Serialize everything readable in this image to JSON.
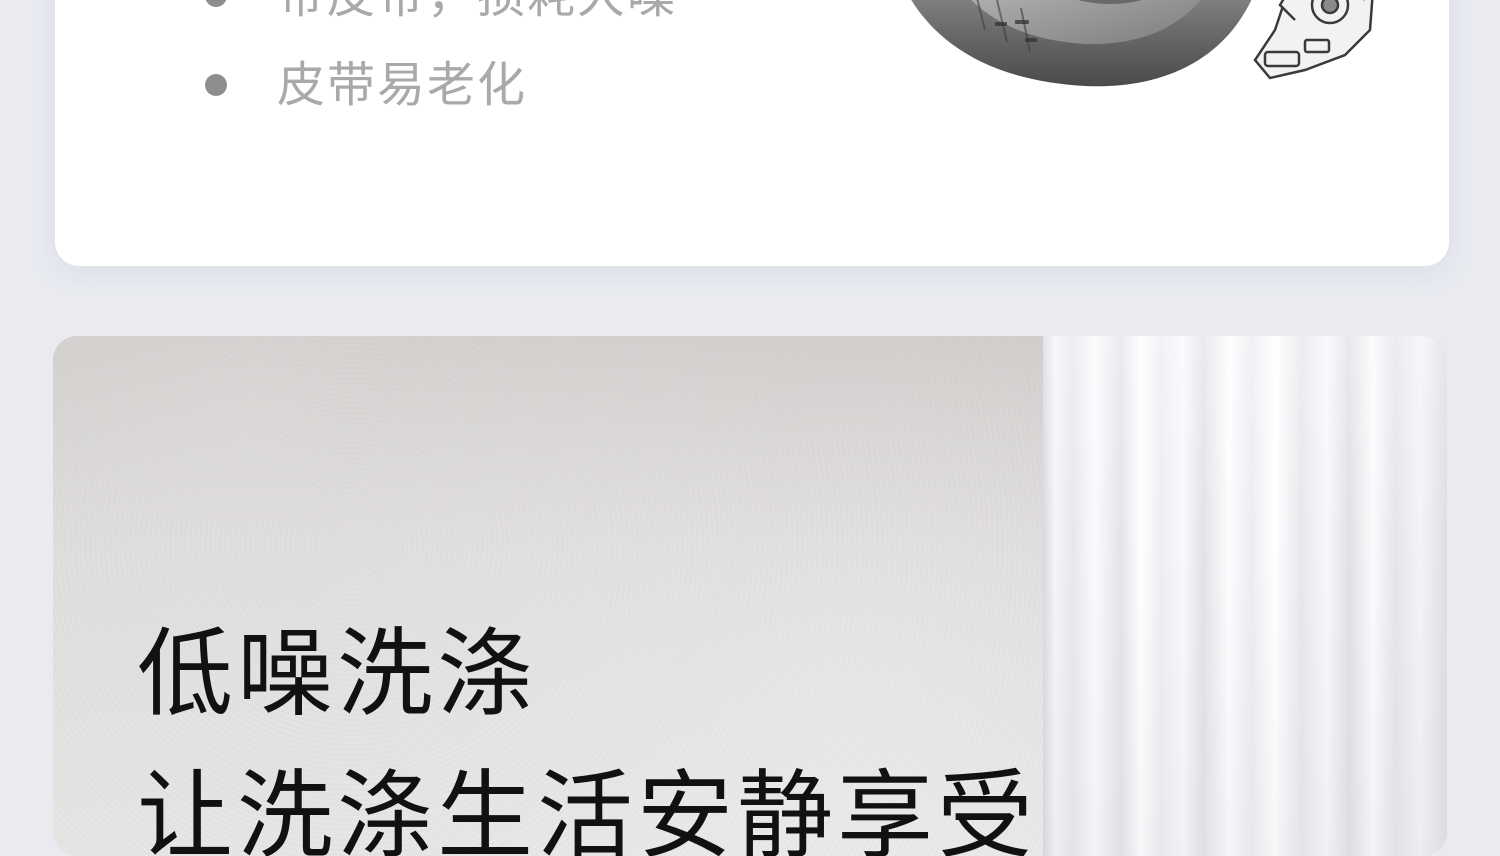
{
  "top_card": {
    "bullets": [
      {
        "text": "带皮带，损耗大噪"
      },
      {
        "text": "皮带易老化"
      }
    ],
    "illustration_icon": "washer-drum-with-belt-motor-illustration"
  },
  "feature_card": {
    "headline_line1": "低噪洗涤",
    "headline_line2": "让洗涤生活安静享受",
    "background_icon": "white-wall-and-sheer-curtain-photo"
  },
  "colors": {
    "page_background": "#e9ebf1",
    "card_background": "#ffffff",
    "bullet_dot": "#8e8e8e",
    "bullet_text": "#a9a9a9",
    "headline_text": "#111111"
  }
}
